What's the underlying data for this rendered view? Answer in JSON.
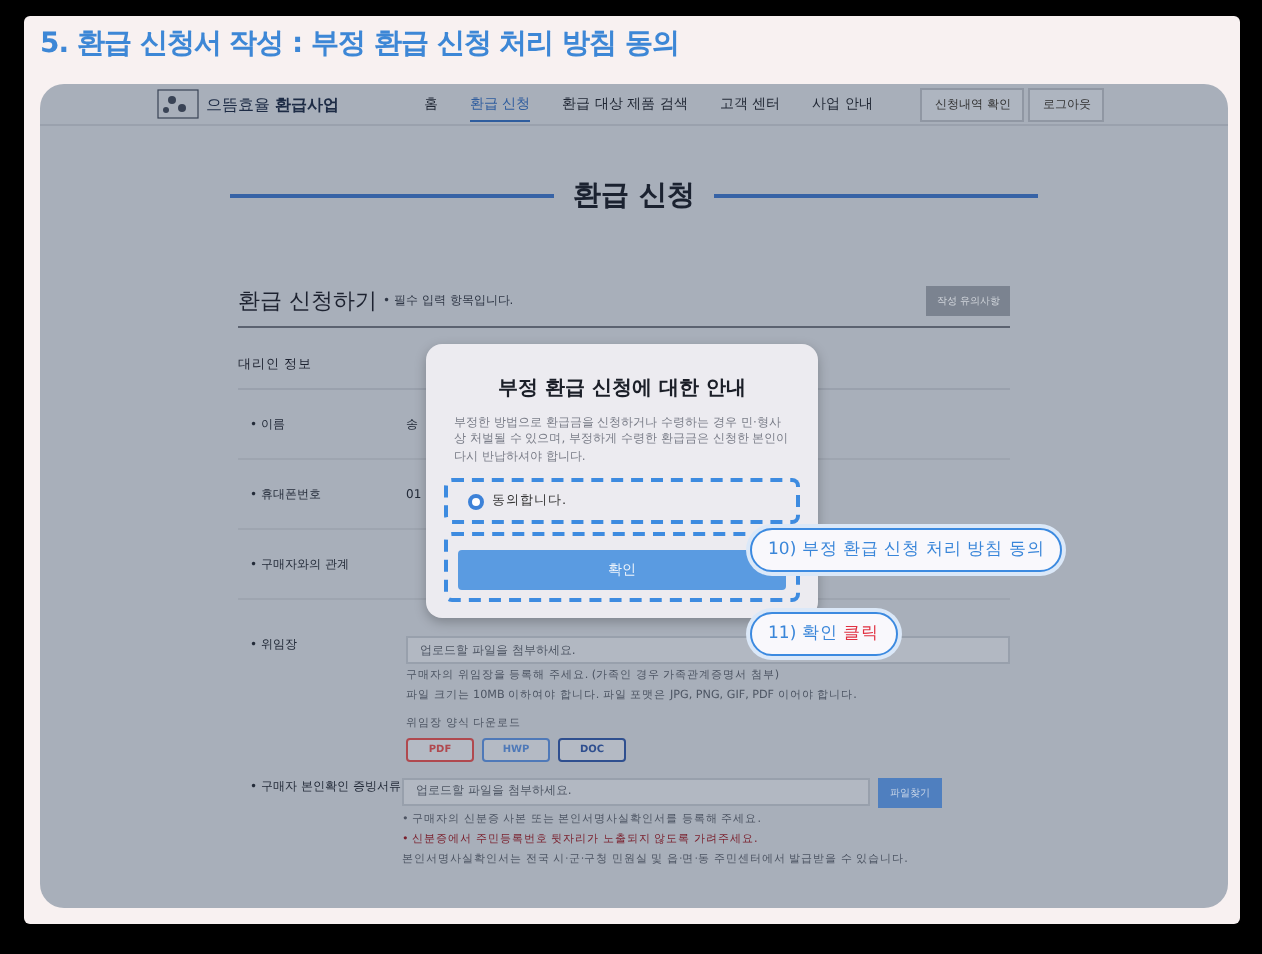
{
  "heading": "5. 환급 신청서 작성 : 부정 환급 신청 처리 방침 동의",
  "nav": {
    "logo_light": "으뜸효율",
    "logo_bold": "환급사업",
    "items": [
      {
        "label": "홈",
        "selected": false
      },
      {
        "label": "환급 신청",
        "selected": true
      },
      {
        "label": "환급 대상 제품 검색",
        "selected": false
      },
      {
        "label": "고객 센터",
        "selected": false
      },
      {
        "label": "사업 안내",
        "selected": false
      }
    ],
    "buttons": [
      "신청내역 확인",
      "로그아웃"
    ]
  },
  "page_title": "환급 신청",
  "form": {
    "title": "환급 신청하기",
    "required_note": "• 필수 입력 항목입니다.",
    "notice_button": "작성 유의사항",
    "section": "대리인 정보",
    "rows": [
      {
        "label": "• 이름",
        "value": "송"
      },
      {
        "label": "• 휴대폰번호",
        "value": "01"
      },
      {
        "label": "• 구매자와의 관계"
      }
    ],
    "poa": {
      "label": "• 위임장",
      "placeholder": "업로드할 파일을 첨부하세요.",
      "notes": [
        "구매자의 위임장을 등록해 주세요. (가족인 경우 가족관계증명서 첨부)",
        "파일 크기는 10MB 이하여야 합니다. 파일 포맷은 JPG, PNG, GIF, PDF 이어야 합니다."
      ],
      "download_label": "위임장 양식 다운로드",
      "formats": [
        {
          "label": "PDF",
          "color": "#b0494f"
        },
        {
          "label": "HWP",
          "color": "#4f79b8"
        },
        {
          "label": "DOC",
          "color": "#2f4f8f"
        }
      ]
    },
    "id_docs": {
      "label": "• 구매자 본인확인 증빙서류",
      "placeholder": "업로드할 파일을 첨부하세요.",
      "button": "파일찾기",
      "notes": [
        {
          "text": "• 구매자의 신분증 사본 또는 본인서명사실확인서를 등록해 주세요.",
          "warning": false
        },
        {
          "text": "• 신분증에서 주민등록번호 뒷자리가 노출되지 않도록 가려주세요.",
          "warning": true
        },
        {
          "text": "본인서명사실확인서는 전국 시·군·구청 민원실 및 읍·면·동 주민센터에서 발급받을 수 있습니다.",
          "warning": false
        }
      ]
    }
  },
  "modal": {
    "title": "부정 환급 신청에 대한 안내",
    "body": "부정한 방법으로 환급금을 신청하거나 수령하는 경우 민·형사상 처벌될 수 있으며, 부정하게 수령한 환급금은 신청한 본인이 다시 반납하셔야 합니다.",
    "agree": {
      "label": "동의합니다.",
      "checked": true
    },
    "confirm": "확인"
  },
  "callouts": [
    {
      "text": "10) 부정 환급 신청 처리 방침 동의"
    },
    {
      "text": "11) 확인",
      "emphasis": "클릭"
    }
  ]
}
